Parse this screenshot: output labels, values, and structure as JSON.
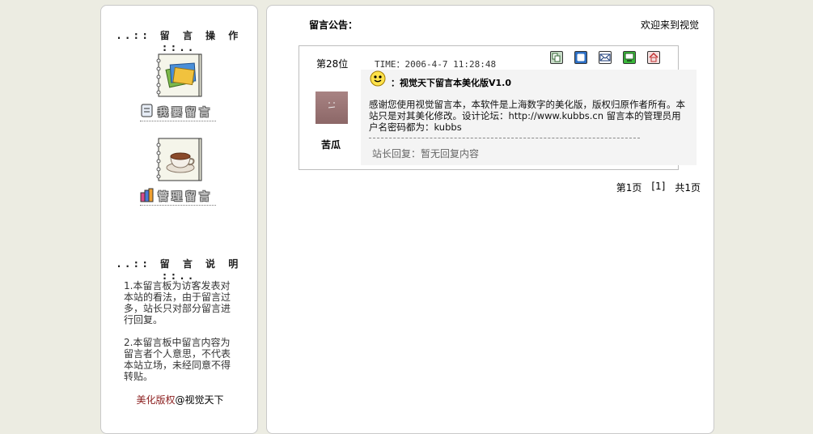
{
  "sidebar": {
    "ops_title": "..:: 留 言 操 作 ::..",
    "write_label": "我要留言",
    "manage_label": "管理留言",
    "notes_title": "..:: 留 言 说 明 ::..",
    "note1": "1.本留言板为访客发表对本站的看法，由于留言过多，站长只对部分留言进行回复。",
    "note2": "2.本留言板中留言内容为留言者个人意思，不代表本站立场，未经同意不得转贴。",
    "copyright_brand": "美化版权",
    "copyright_owner": "@视觉天下"
  },
  "main": {
    "notice_label": "留言公告：",
    "welcome": "欢迎来到视觉"
  },
  "message": {
    "floor": "第28位",
    "username": "苦瓜",
    "time": "TIME：2006-4-7 11:28:48",
    "title": "：视觉天下留言本美化版V1.0",
    "content": "感谢您使用视觉留言本，本软件是上海数字的美化版，版权归原作者所有。本站只是对其美化修改。设计论坛：http://www.kubbs.cn 留言本的管理员用户名密码都为：kubbs",
    "reply": "站长回复：暂无回复内容"
  },
  "pagination": {
    "current": "第1页",
    "pages": "[1]",
    "total": "共1页"
  },
  "toolbar_icons": [
    "copy-icon",
    "window-icon",
    "mail-icon",
    "monitor-icon",
    "home-icon"
  ],
  "colors": {
    "background": "#ecece2",
    "copyright_brand": "#8b1d1d",
    "icon_green": "#3a8a3a",
    "icon_blue": "#2d6fc4",
    "icon_red": "#c23030"
  }
}
